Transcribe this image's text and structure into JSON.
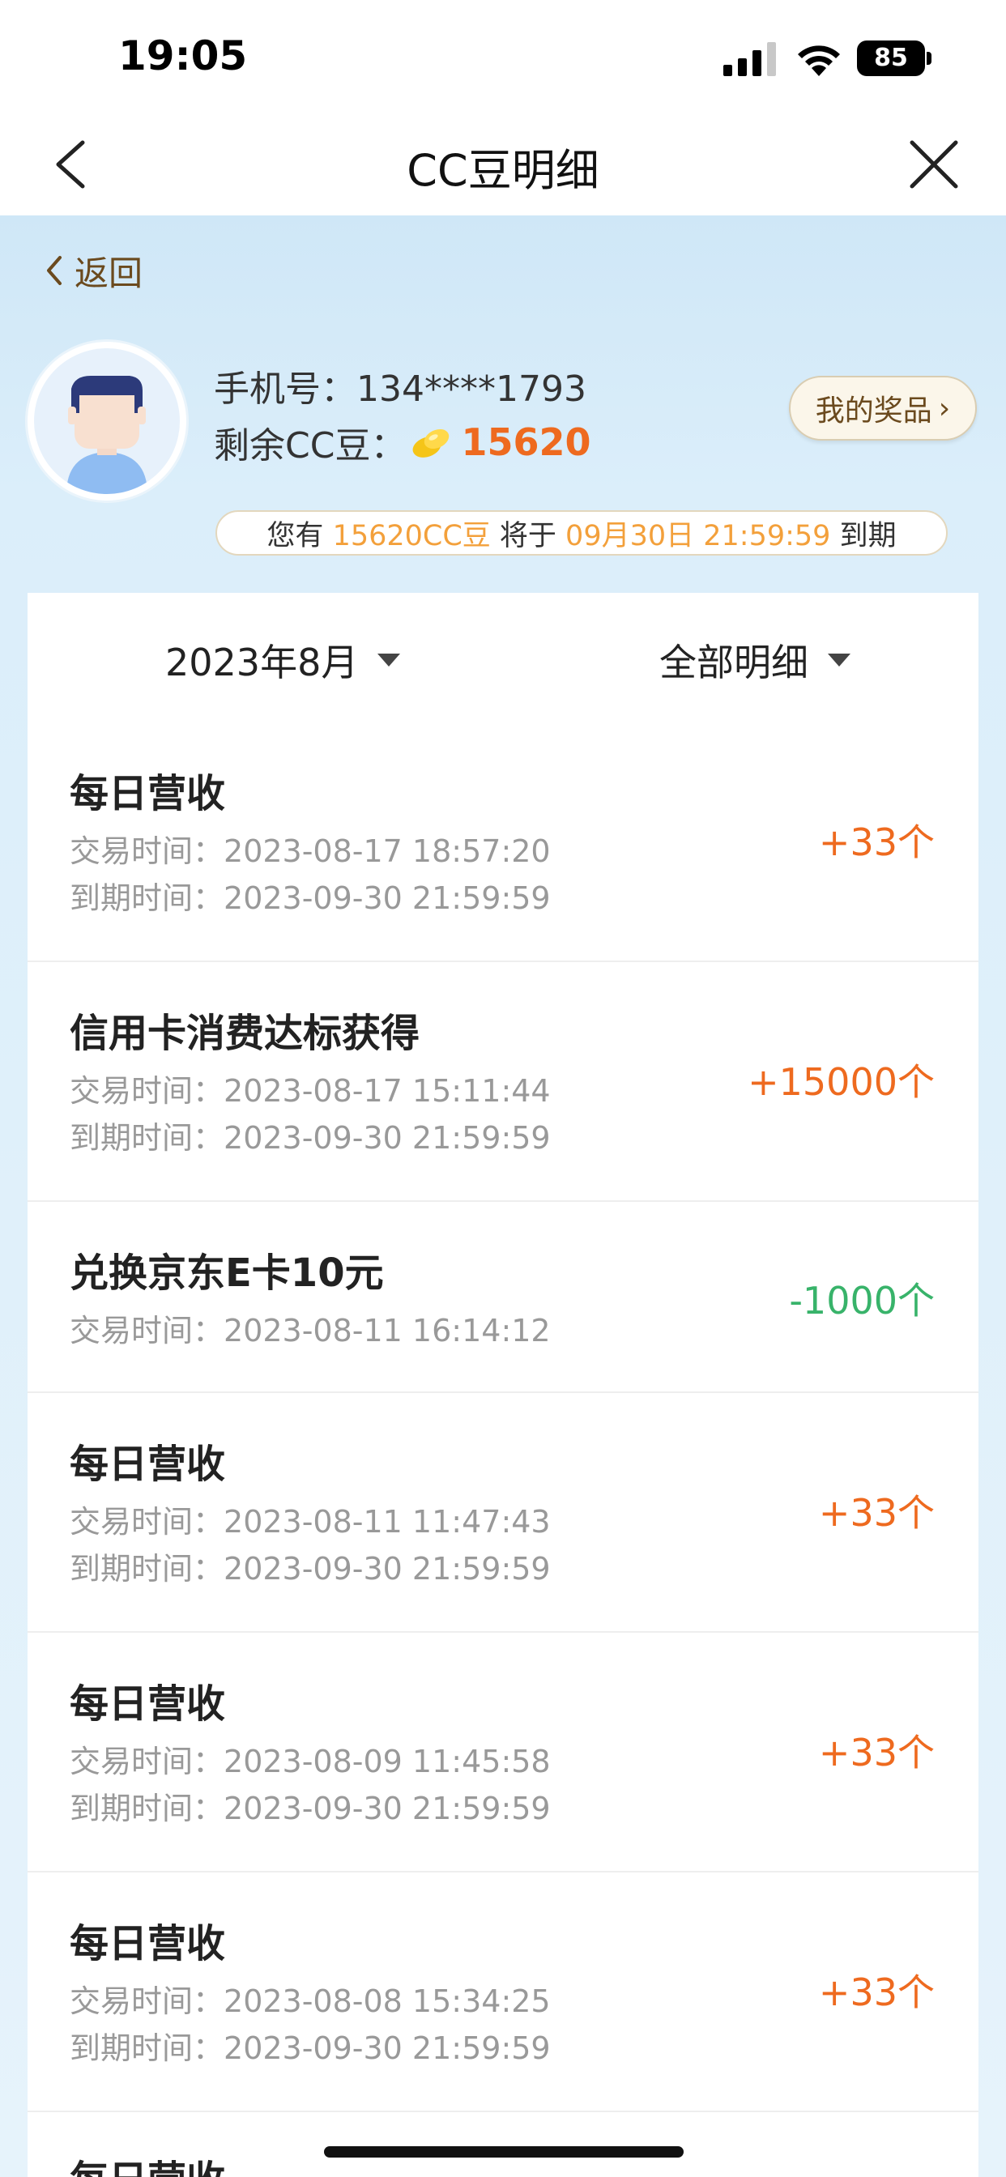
{
  "status_bar": {
    "time": "19:05",
    "battery": "85"
  },
  "nav": {
    "title": "CC豆明细"
  },
  "header": {
    "return_label": "返回",
    "phone_label": "手机号：",
    "phone_value": "134****1793",
    "beans_label": "剩余CC豆：",
    "beans_value": "15620",
    "prize_label": "我的奖品",
    "expiry": {
      "prefix": "您有 ",
      "amount": "15620CC豆",
      "middle": " 将于 ",
      "date": "09月30日 21:59:59",
      "suffix": " 到期"
    }
  },
  "filters": {
    "month": "2023年8月",
    "type": "全部明细"
  },
  "labels": {
    "trade_time": "交易时间：",
    "expire_time": "到期时间："
  },
  "records": [
    {
      "title": "每日营收",
      "trade": "2023-08-17 18:57:20",
      "expire": "2023-09-30 21:59:59",
      "amount": "+33个",
      "sign": "positive"
    },
    {
      "title": "信用卡消费达标获得",
      "trade": "2023-08-17 15:11:44",
      "expire": "2023-09-30 21:59:59",
      "amount": "+15000个",
      "sign": "positive"
    },
    {
      "title": "兑换京东E卡10元",
      "trade": "2023-08-11 16:14:12",
      "amount": "-1000个",
      "sign": "negative"
    },
    {
      "title": "每日营收",
      "trade": "2023-08-11 11:47:43",
      "expire": "2023-09-30 21:59:59",
      "amount": "+33个",
      "sign": "positive"
    },
    {
      "title": "每日营收",
      "trade": "2023-08-09 11:45:58",
      "expire": "2023-09-30 21:59:59",
      "amount": "+33个",
      "sign": "positive"
    },
    {
      "title": "每日营收",
      "trade": "2023-08-08 15:34:25",
      "expire": "2023-09-30 21:59:59",
      "amount": "+33个",
      "sign": "positive"
    },
    {
      "title": "每日营收"
    }
  ],
  "colors": {
    "positive": "#ee6a1f",
    "negative": "#38b36a",
    "highlight": "#f3a03b",
    "header_bg": "#cfe7f7"
  }
}
